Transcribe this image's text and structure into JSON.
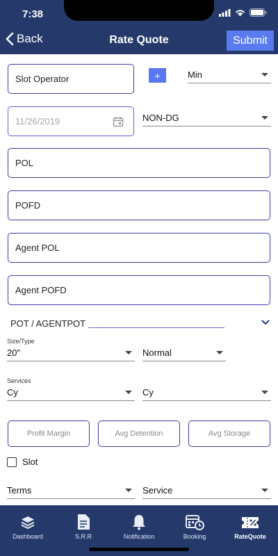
{
  "status": {
    "time": "7:38"
  },
  "header": {
    "back_label": "Back",
    "title": "Rate Quote",
    "submit_label": "Submit"
  },
  "form": {
    "slot_operator": "Slot Operator",
    "plus": "+",
    "min_select": "Min",
    "date_placeholder": "11/26/2019",
    "cargo_type": "NON-DG",
    "pol": "POL",
    "pofd": "POFD",
    "agent_pol": "Agent POL",
    "agent_pofd": "Agent POFD",
    "pot_label": "POT / AGENTPOT",
    "size_type_label": "Size/Type",
    "size_value": "20\"",
    "type_value": "Normal",
    "services_label": "Services",
    "services_value1": "Cy",
    "services_value2": "Cy",
    "profit_margin": "Profit Margin",
    "avg_detention": "Avg Detention",
    "avg_storage": "Avg Storage",
    "slot_label": "Slot",
    "terms_label": "Terms",
    "service_label": "Service"
  },
  "tabs": [
    {
      "label": "Dashboard",
      "icon": "layers-icon"
    },
    {
      "label": "S.R.R",
      "icon": "document-icon"
    },
    {
      "label": "Notification",
      "icon": "bell-icon"
    },
    {
      "label": "Booking",
      "icon": "calendar-clock-icon"
    },
    {
      "label": "RateQuote",
      "icon": "ticket-percent-icon"
    }
  ],
  "colors": {
    "header_bg": "#253a6b",
    "accent": "#5a7bf0",
    "border": "#3b3ba8"
  }
}
